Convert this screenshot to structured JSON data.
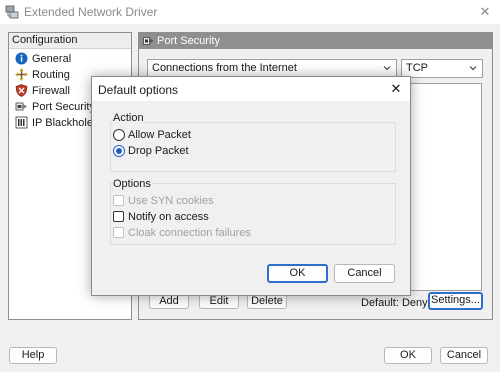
{
  "window": {
    "title": "Extended Network Driver",
    "close_glyph": "✕"
  },
  "sidebar": {
    "header": "Configuration",
    "items": [
      {
        "label": "General",
        "icon": "info-icon"
      },
      {
        "label": "Routing",
        "icon": "routing-icon"
      },
      {
        "label": "Firewall",
        "icon": "shield-icon"
      },
      {
        "label": "Port Security",
        "icon": "port-icon"
      },
      {
        "label": "IP Blackhole",
        "icon": "blackhole-icon"
      }
    ]
  },
  "panel": {
    "header": "Port Security",
    "connection_select": "Connections from the Internet",
    "protocol_select": "TCP",
    "add_label": "Add",
    "edit_label": "Edit",
    "delete_label": "Delete",
    "default_status": "Default: Deny",
    "settings_label": "Settings..."
  },
  "footer": {
    "help_label": "Help",
    "ok_label": "OK",
    "cancel_label": "Cancel"
  },
  "dialog": {
    "title": "Default options",
    "close_glyph": "✕",
    "action_group": "Action",
    "allow_label": "Allow Packet",
    "drop_label": "Drop Packet",
    "selected_action": "Drop Packet",
    "options_group": "Options",
    "syn_label": "Use SYN cookies",
    "notify_label": "Notify on access",
    "cloak_label": "Cloak connection failures",
    "ok_label": "OK",
    "cancel_label": "Cancel"
  },
  "colors": {
    "accent": "#2f6fcb",
    "panel_header": "#8f8f8f",
    "firewall_red": "#c0392b",
    "info_blue": "#1565c0"
  }
}
